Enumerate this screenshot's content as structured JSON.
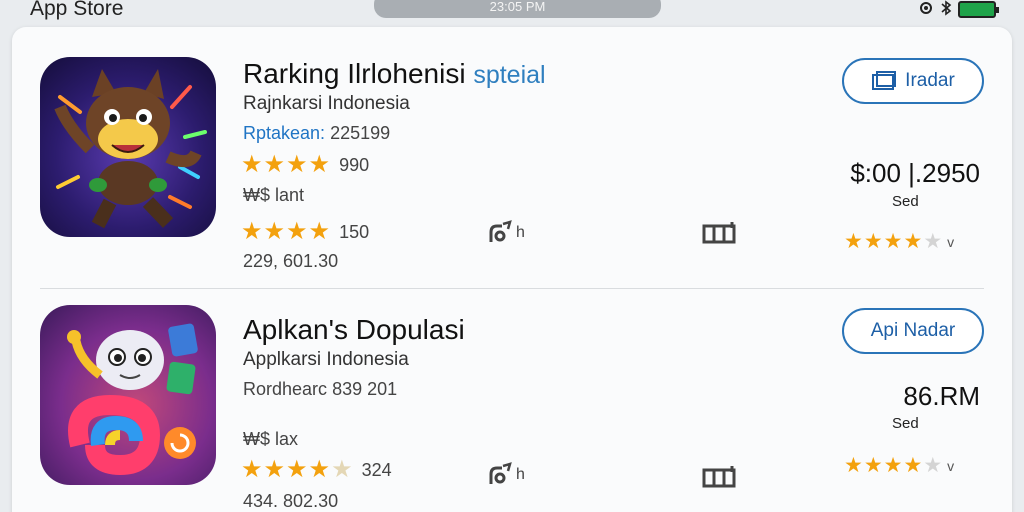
{
  "status_bar": {
    "app_title": "App Store",
    "time": "23:05 PM",
    "indicators": [
      "location-icon",
      "bluetooth-icon",
      "battery-icon"
    ]
  },
  "apps": [
    {
      "title": "Rarking Ilrlohenisi",
      "title_accent": "spteial",
      "subtitle": "Rajnkarsi Indonesia",
      "line3_label": "Rptakean:",
      "line3_value": "225199",
      "stars_1": "★★★★",
      "count_1": "990",
      "meta_1": "₩$ lant",
      "stars_2": "★★★★",
      "count_2": "150",
      "meta_2": "229, 601.30",
      "button_label": "Iradar",
      "price": "$:00 |.2950",
      "price_sub": "Sed",
      "right_stars_full": "★★★★",
      "right_stars_empty": "★",
      "icon_theme": "cartoon-cat-icon"
    },
    {
      "title": "Aplkan's Dopulasi",
      "title_accent": "",
      "subtitle": "Applkarsi Indonesia",
      "line3_label": "Rordhearc",
      "line3_value": "839 201",
      "stars_1": "★★★★",
      "stars_1_half": "★",
      "count_1": "324",
      "meta_1": "₩$ lax",
      "button_label": "Api Nadar",
      "price": "86.RM",
      "price_sub": "Sed",
      "meta_2": "434. 802.30",
      "right_stars_full": "★★★★",
      "right_stars_empty": "★",
      "icon_theme": "cartoon-worm-icon"
    }
  ],
  "colors": {
    "accent": "#2a74b8",
    "star": "#f3a10e",
    "card_bg": "#fafbfc",
    "page_bg": "#e9ecef"
  }
}
